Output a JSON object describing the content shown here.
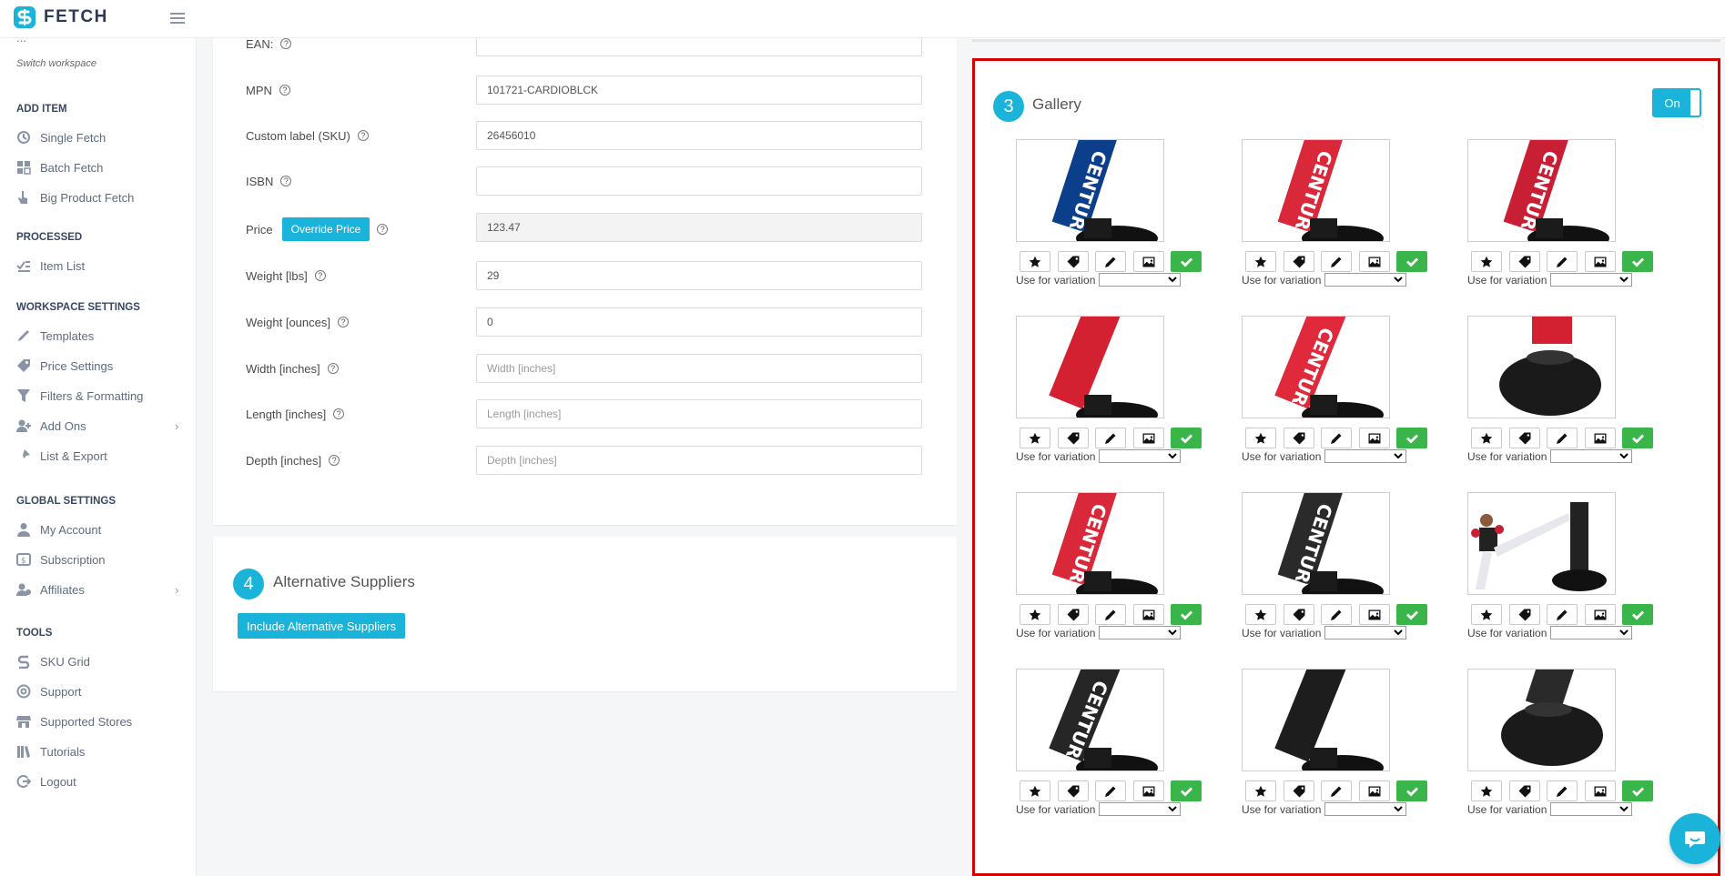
{
  "brand": {
    "name": "FETCH",
    "accent": "#1ab3d9",
    "highlight_border": "#d40000",
    "ok_color": "#39b54a"
  },
  "sidebar": {
    "workspace_name_partial": "...",
    "switch_workspace": "Switch workspace",
    "sections": [
      {
        "title": "ADD ITEM",
        "items": [
          {
            "label": "Single Fetch",
            "icon": "single-fetch-icon"
          },
          {
            "label": "Batch Fetch",
            "icon": "batch-fetch-icon"
          },
          {
            "label": "Big Product Fetch",
            "icon": "big-product-fetch-icon"
          }
        ]
      },
      {
        "title": "PROCESSED",
        "items": [
          {
            "label": "Item List",
            "icon": "item-list-icon"
          }
        ]
      },
      {
        "title": "WORKSPACE SETTINGS",
        "items": [
          {
            "label": "Templates",
            "icon": "templates-icon"
          },
          {
            "label": "Price Settings",
            "icon": "price-settings-icon"
          },
          {
            "label": "Filters & Formatting",
            "icon": "filter-icon"
          },
          {
            "label": "Add Ons",
            "icon": "add-ons-icon",
            "expandable": true
          },
          {
            "label": "List & Export",
            "icon": "list-export-icon"
          }
        ]
      },
      {
        "title": "GLOBAL SETTINGS",
        "items": [
          {
            "label": "My Account",
            "icon": "user-icon"
          },
          {
            "label": "Subscription",
            "icon": "subscription-icon"
          },
          {
            "label": "Affiliates",
            "icon": "affiliates-icon",
            "expandable": true
          }
        ]
      },
      {
        "title": "TOOLS",
        "items": [
          {
            "label": "SKU Grid",
            "icon": "sku-grid-icon"
          },
          {
            "label": "Support",
            "icon": "support-icon"
          },
          {
            "label": "Supported Stores",
            "icon": "store-icon"
          },
          {
            "label": "Tutorials",
            "icon": "tutorials-icon"
          },
          {
            "label": "Logout",
            "icon": "logout-icon"
          }
        ]
      }
    ]
  },
  "form": {
    "fields": [
      {
        "key": "ean",
        "label": "EAN:",
        "value": "",
        "placeholder": ""
      },
      {
        "key": "mpn",
        "label": "MPN",
        "value": "101721-CARDIOBLCK",
        "placeholder": ""
      },
      {
        "key": "sku",
        "label": "Custom label (SKU)",
        "value": "26456010",
        "placeholder": ""
      },
      {
        "key": "isbn",
        "label": "ISBN",
        "value": "",
        "placeholder": ""
      },
      {
        "key": "price",
        "label": "Price",
        "value": "123.47",
        "placeholder": "",
        "button": "Override Price"
      },
      {
        "key": "weight_lbs",
        "label": "Weight [lbs]",
        "value": "29",
        "placeholder": ""
      },
      {
        "key": "weight_oz",
        "label": "Weight [ounces]",
        "value": "0",
        "placeholder": ""
      },
      {
        "key": "width",
        "label": "Width [inches]",
        "value": "",
        "placeholder": "Width [inches]"
      },
      {
        "key": "length",
        "label": "Length [inches]",
        "value": "",
        "placeholder": "Length [inches]"
      },
      {
        "key": "depth",
        "label": "Depth [inches]",
        "value": "",
        "placeholder": "Depth [inches]"
      }
    ]
  },
  "alt_suppliers": {
    "step": "4",
    "title": "Alternative Suppliers",
    "button": "Include Alternative Suppliers"
  },
  "gallery": {
    "step": "3",
    "title": "Gallery",
    "toggle_label": "On",
    "variation_label": "Use for variation",
    "variation_selected": "",
    "action_icons": [
      "star-icon",
      "tag-icon",
      "pencil-icon",
      "image-icon",
      "check-icon"
    ],
    "images": [
      {
        "kind": "pole-blue-logo"
      },
      {
        "kind": "pole-red-logo"
      },
      {
        "kind": "pole-red-logo-2"
      },
      {
        "kind": "pole-red-plain"
      },
      {
        "kind": "pole-red-century"
      },
      {
        "kind": "base-black-top"
      },
      {
        "kind": "pole-red-logo-3"
      },
      {
        "kind": "pole-black-logo"
      },
      {
        "kind": "kicker-photo"
      },
      {
        "kind": "pole-black-century"
      },
      {
        "kind": "pole-black-plain"
      },
      {
        "kind": "base-black-top-2"
      }
    ]
  }
}
